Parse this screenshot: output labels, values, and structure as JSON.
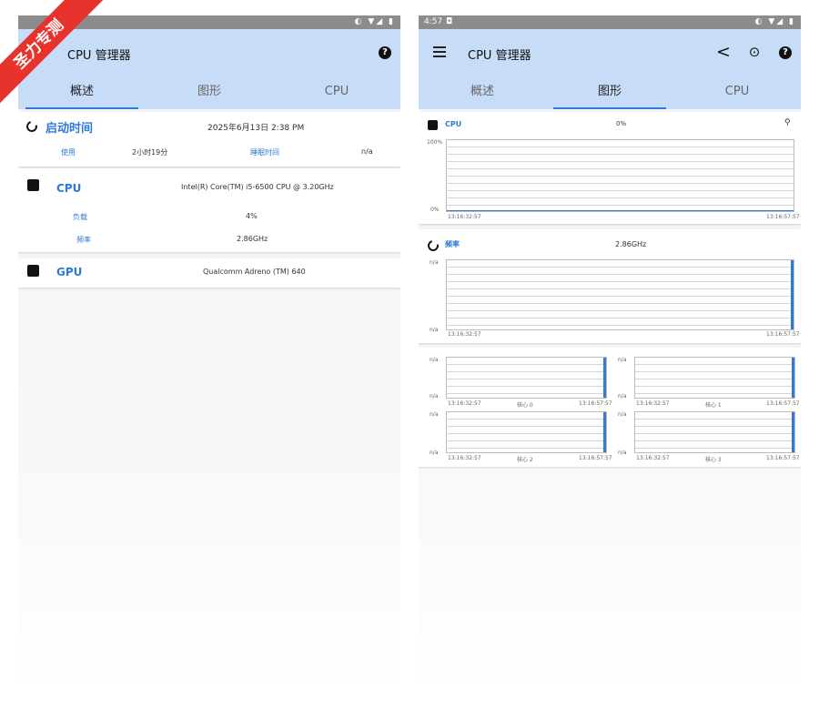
{
  "watermark": "圣力专测",
  "left": {
    "status": {
      "icons": "◐ ▼◢ ▮"
    },
    "toolbar": {
      "title": "CPU 管理器"
    },
    "tabs": [
      "概述",
      "图形",
      "CPU"
    ],
    "uptime": {
      "title": "启动时间",
      "value": "2025年6月13日 2:38 PM",
      "used_label": "使用",
      "used_value": "2小时19分",
      "sleep_label": "睡眠时间",
      "sleep_value": "n/a"
    },
    "cpu": {
      "title": "CPU",
      "model": "Intel(R) Core(TM) i5-6500 CPU @ 3.20GHz",
      "load_label": "负载",
      "load_value": "4%",
      "freq_label": "频率",
      "freq_value": "2.86GHz"
    },
    "gpu": {
      "title": "GPU",
      "model": "Qualcomm Adreno (TM) 640"
    }
  },
  "right": {
    "status": {
      "time": "4:57",
      "notif": "◘",
      "icons": "◐ ▼◢ ▮"
    },
    "toolbar": {
      "title": "CPU 管理器"
    },
    "tabs": [
      "概述",
      "图形",
      "CPU"
    ],
    "cpu_chart": {
      "label": "CPU",
      "value": "0%",
      "y_top": "100%",
      "y_bottom": "0%",
      "x_start": "13:16:32:57",
      "x_end": "13:16:57:57",
      "level": 0
    },
    "freq_chart": {
      "label": "频率",
      "value": "2.86GHz",
      "y_top": "n/a",
      "y_bottom": "n/a",
      "x_start": "13:16:32:57",
      "x_end": "13:16:57:57"
    },
    "cores": [
      {
        "label": "核心 0",
        "y_top": "n/a",
        "y_bottom": "n/a",
        "x_start": "13:16:32:57",
        "x_end": "13:16:57:57"
      },
      {
        "label": "核心 1",
        "y_top": "n/a",
        "y_bottom": "n/a",
        "x_start": "13:16:32:57",
        "x_end": "13:16:57:57"
      },
      {
        "label": "核心 2",
        "y_top": "n/a",
        "y_bottom": "n/a",
        "x_start": "13:16:32:57",
        "x_end": "13:16:57:57"
      },
      {
        "label": "核心 3",
        "y_top": "n/a",
        "y_bottom": "n/a",
        "x_start": "13:16:32:57",
        "x_end": "13:16:57:57"
      }
    ]
  }
}
